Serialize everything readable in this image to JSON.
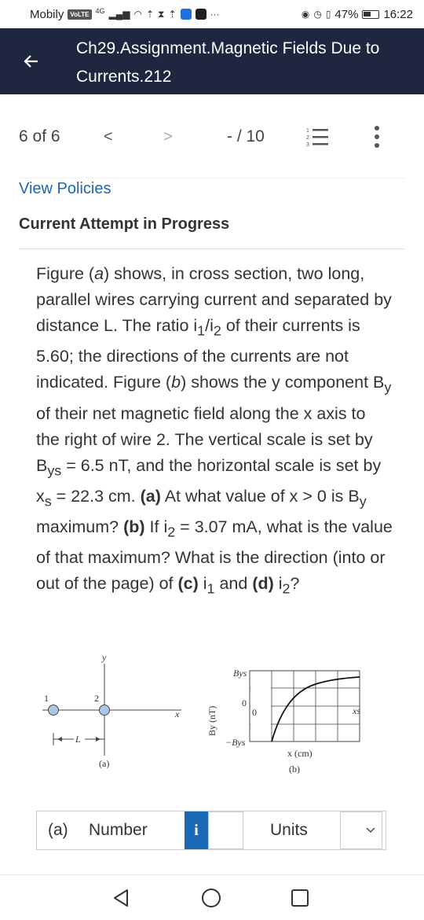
{
  "status_bar": {
    "carrier": "Mobily",
    "volte": "VoLTE",
    "network": "4G",
    "battery": "47%",
    "time": "16:22"
  },
  "header": {
    "title": "Ch29.Assignment.Magnetic Fields Due to Currents.212"
  },
  "nav": {
    "position": "6 of 6",
    "prev": "<",
    "next": ">",
    "score": "- / 10"
  },
  "links": {
    "view_policies": "View Policies"
  },
  "attempt_status": "Current Attempt in Progress",
  "question": {
    "p1": "Figure (",
    "p1a": "a",
    "p2": ") shows, in cross section, two long, parallel wires carrying current and separated by distance L. The ratio i",
    "p3": "/i",
    "p4": " of their currents is 5.60; the directions of the currents are not indicated. Figure (",
    "p4b": "b",
    "p5": ") shows the y component B",
    "p6": " of their net magnetic field along the x axis to the right of wire 2. The vertical scale is set by B",
    "p7": " = 6.5 nT, and the horizontal scale is set by x",
    "p8": " = 22.3 cm. ",
    "a_label": "(a)",
    "a_text": " At what value of x > 0 is B",
    "b_pre": " maximum? ",
    "b_label": "(b)",
    "b_text": " If i",
    "b_text2": " = 3.07 mA, what is the value of that maximum? What is the direction (into or out of the page) of ",
    "c_label": "(c)",
    "c_text": " i",
    "d_pre": " and ",
    "d_label": "(d)",
    "d_text": " i",
    "end": "?",
    "sub_1": "1",
    "sub_2": "2",
    "sub_y": "y",
    "sub_ys": "ys",
    "sub_s": "s"
  },
  "figure": {
    "a": {
      "axis_y": "y",
      "axis_x": "x",
      "wire1": "1",
      "wire2": "2",
      "L": "L",
      "caption": "(a)"
    },
    "b": {
      "ylabel": "By (nT)",
      "tick_top": "Bys",
      "tick_zero": "0",
      "tick_bottom": "−Bys",
      "x_origin": "0",
      "x_end": "xs",
      "xlabel": "x (cm)",
      "caption": "(b)"
    }
  },
  "answer": {
    "part": "(a)",
    "type": "Number",
    "info": "i",
    "value": "",
    "units_label": "Units",
    "units_value": ""
  }
}
